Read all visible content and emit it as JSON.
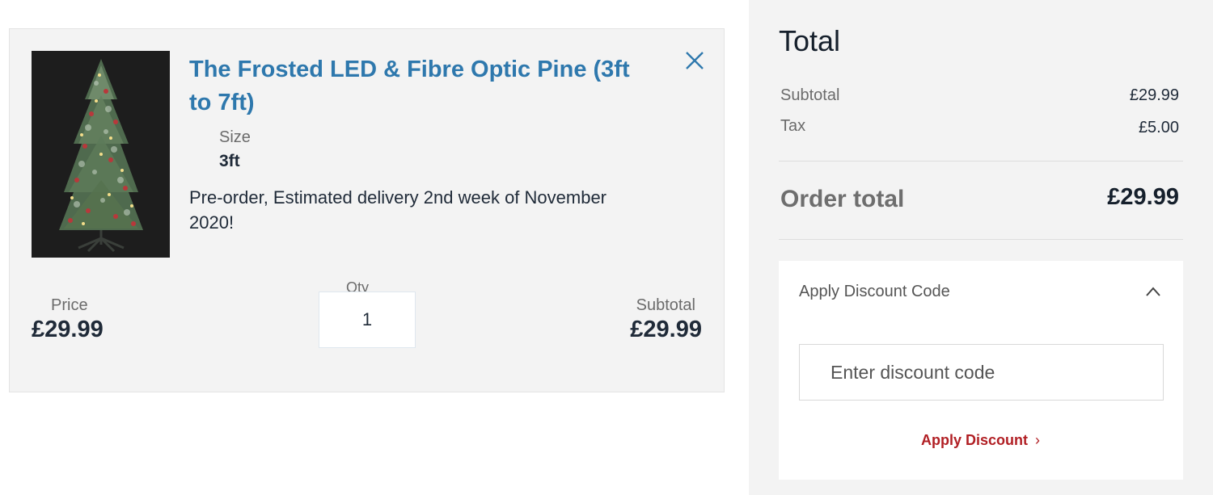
{
  "cart_item": {
    "title": "The Frosted LED & Fibre Optic Pine (3ft to 7ft)",
    "image_alt": "Frosted fibre optic pine tree",
    "size_label": "Size",
    "size_value": "3ft",
    "delivery_note": "Pre-order, Estimated delivery 2nd week of November 2020!",
    "price_label": "Price",
    "price_value": "£29.99",
    "qty_label": "Qty",
    "qty_value": "1",
    "subtotal_label": "Subtotal",
    "subtotal_value": "£29.99",
    "remove_icon": "close-icon"
  },
  "summary": {
    "title": "Total",
    "subtotal_label": "Subtotal",
    "subtotal_value": "£29.99",
    "tax_label": "Tax",
    "tax_value": "£5.00",
    "order_total_label": "Order total",
    "order_total_value": "£29.99"
  },
  "discount": {
    "title": "Apply Discount Code",
    "input_value": "",
    "input_placeholder": "Enter discount code",
    "apply_label": "Apply Discount",
    "apply_chevron": "›",
    "toggle_icon": "chevron-up-icon"
  },
  "colors": {
    "title_link": "#2e78ad",
    "apply_link": "#b11f24",
    "panel_bg": "#f3f3f3",
    "text_dark": "#1f2a38"
  }
}
